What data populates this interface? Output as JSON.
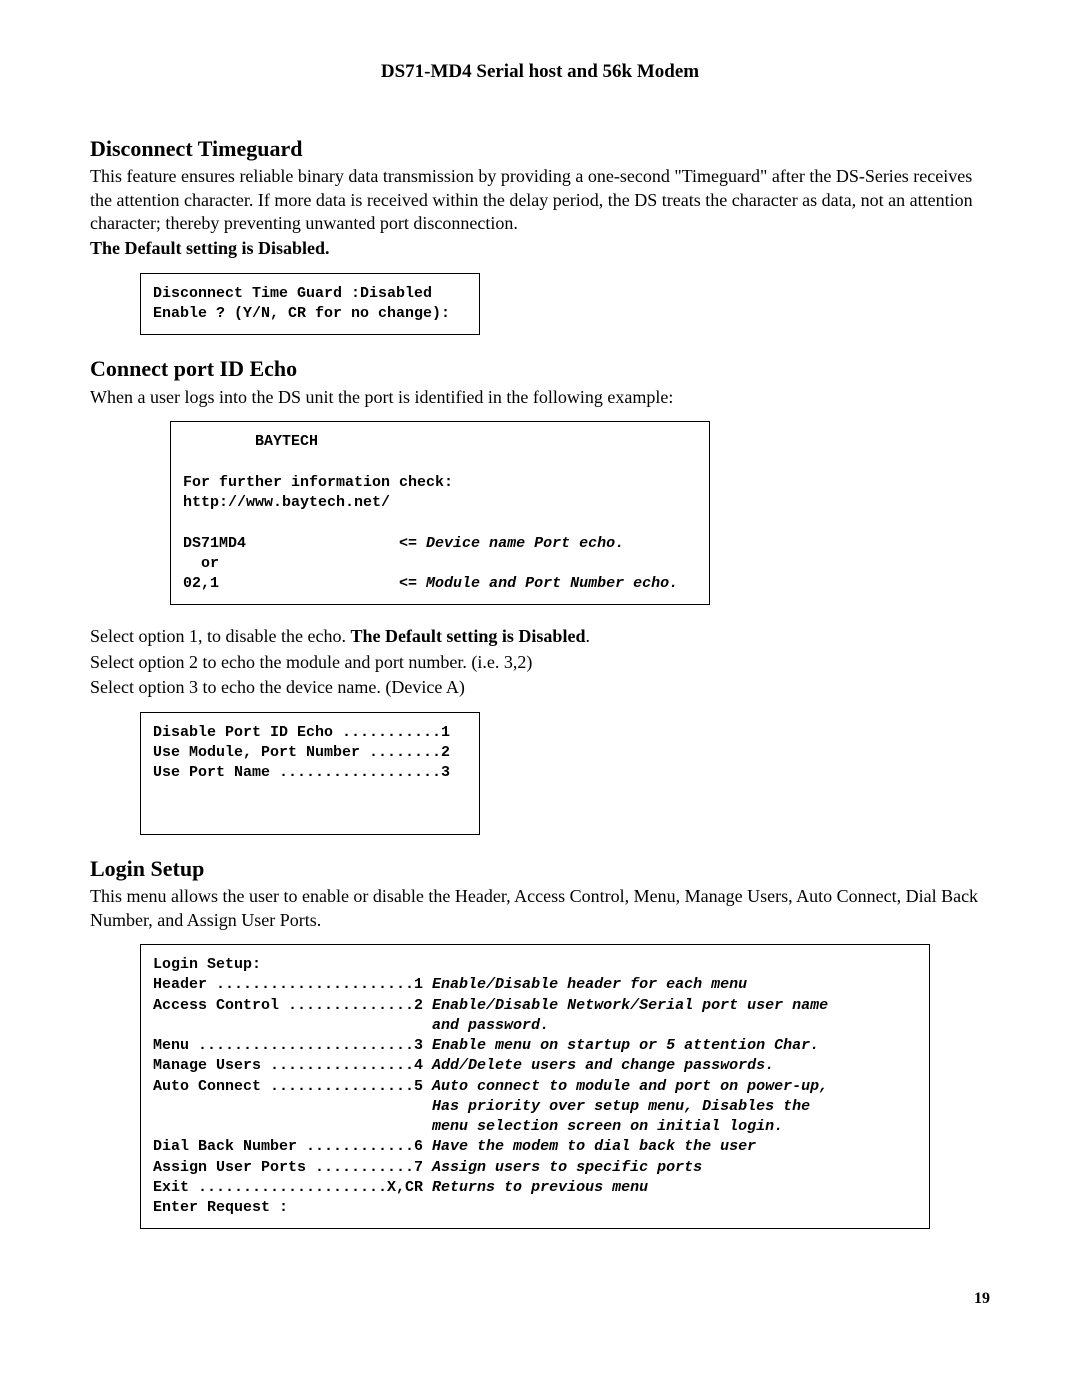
{
  "header": {
    "title": "DS71-MD4 Serial host and 56k Modem"
  },
  "section1": {
    "heading": "Disconnect Timeguard",
    "para": "This feature ensures reliable binary data transmission by providing a one-second \"Timeguard\" after the DS-Series receives the attention character.  If more data is received within the delay period, the DS treats the character as data, not an attention character; thereby preventing unwanted port disconnection.",
    "bold_line": "The Default setting is Disabled.",
    "box": {
      "line1": "Disconnect Time Guard :Disabled",
      "line2": "Enable ? (Y/N, CR for no change):"
    }
  },
  "section2": {
    "heading": "Connect port ID Echo",
    "para": "When a user logs into the DS unit the port is identified in the following example:",
    "box": {
      "line1": "        BAYTECH",
      "line2": "",
      "line3": "For further information check:",
      "line4": "http://www.baytech.net/",
      "line5": "",
      "line6a": "DS71MD4                 ",
      "line6b": "<= Device name Port echo.",
      "line7": "  or",
      "line8a": "02,1                    ",
      "line8b": "<= Module and Port Number echo."
    },
    "post1a": "Select option 1, to disable the echo. ",
    "post1b": "The Default setting is Disabled",
    "post1c": ".",
    "post2": "Select option 2 to echo the module and port number. (i.e. 3,2)",
    "post3": "Select option 3 to echo the device name. (Device A)",
    "menu_box": {
      "line1": "Disable Port ID Echo ...........1",
      "line2": "Use Module, Port Number ........2",
      "line3": "Use Port Name ..................3"
    }
  },
  "section3": {
    "heading": "Login Setup",
    "para": "This menu allows the user to enable or disable the Header, Access Control, Menu, Manage Users, Auto Connect, Dial Back Number, and Assign User Ports.",
    "box": {
      "l1": "Login Setup:",
      "l2a": "Header ......................1 ",
      "l2b": "Enable/Disable header for each menu",
      "l3a": "Access Control ..............2 ",
      "l3b": "Enable/Disable Network/Serial port user name",
      "l3c": "                               and password.",
      "l4a": "Menu ........................3 ",
      "l4b": "Enable menu on startup or 5 attention Char.",
      "l5a": "Manage Users ................4 ",
      "l5b": "Add/Delete users and change passwords.",
      "l6a": "Auto Connect ................5 ",
      "l6b": "Auto connect to module and port on power-up,",
      "l6c": "                               Has priority over setup menu, Disables the",
      "l6d": "                               menu selection screen on initial login.",
      "l7a": "Dial Back Number ............6 ",
      "l7b": "Have the modem to dial back the user",
      "l8a": "Assign User Ports ...........7 ",
      "l8b": "Assign users to specific ports",
      "l9a": "Exit .....................X,CR ",
      "l9b": "Returns to previous menu",
      "l10": "Enter Request :"
    }
  },
  "page_number": "19"
}
